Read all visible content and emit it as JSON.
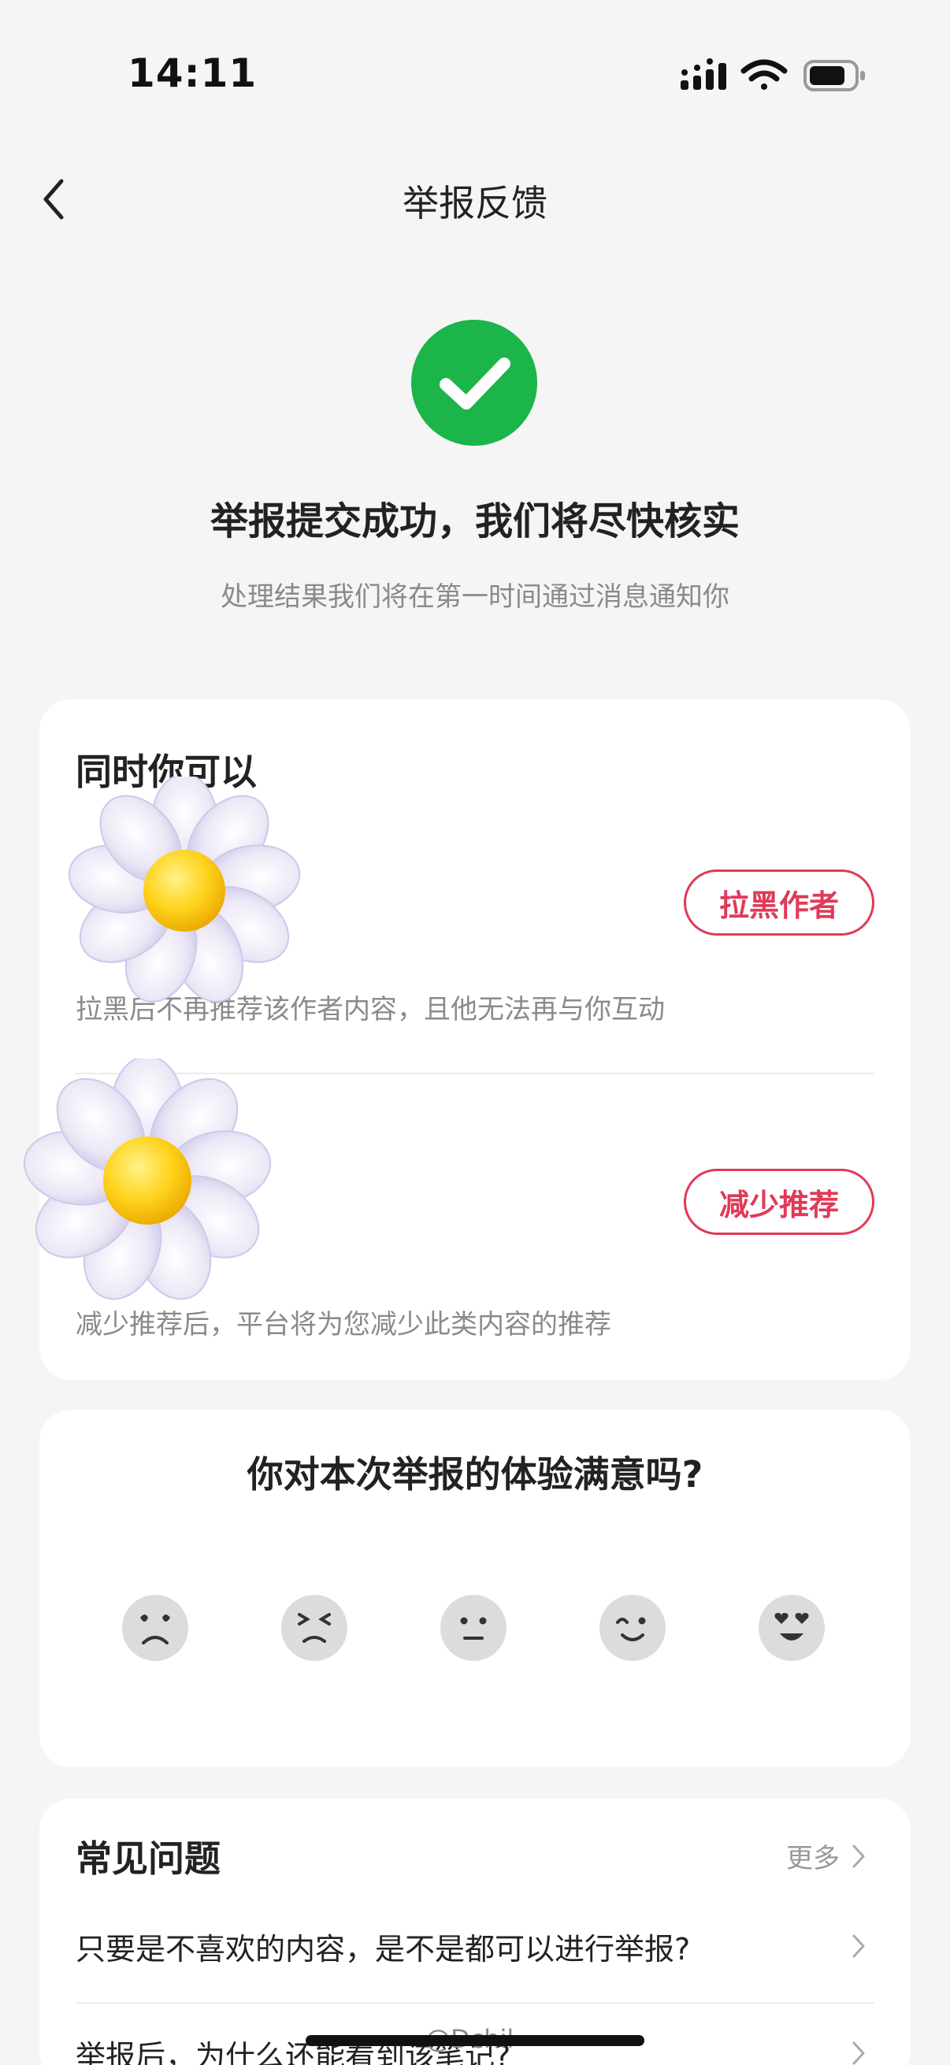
{
  "status_bar": {
    "time": "14:11",
    "icons": [
      "signal-icon",
      "wifi-icon",
      "battery-icon"
    ]
  },
  "nav": {
    "title": "举报反馈",
    "back_icon": "chevron-left-icon"
  },
  "success": {
    "icon": "check-circle-icon",
    "title": "举报提交成功，我们将尽快核实",
    "subtitle": "处理结果我们将在第一时间通过消息通知你"
  },
  "actions": {
    "heading": "同时你可以",
    "items": [
      {
        "button": "拉黑作者",
        "description": "拉黑后不再推荐该作者内容，且他无法再与你互动"
      },
      {
        "button": "减少推荐",
        "description": "减少推荐后，平台将为您减少此类内容的推荐"
      }
    ]
  },
  "survey": {
    "title": "你对本次举报的体验满意吗?",
    "options": [
      "very-unsatisfied-emoji",
      "unsatisfied-emoji",
      "neutral-emoji",
      "satisfied-emoji",
      "very-satisfied-emoji"
    ]
  },
  "faq": {
    "title": "常见问题",
    "more": "更多",
    "questions": [
      "只要是不喜欢的内容，是不是都可以进行举报?",
      "举报后，为什么还能看到该笔记?"
    ]
  },
  "watermark": "@Dchil",
  "colors": {
    "accent": "#e03a58",
    "success": "#1bb54a",
    "background": "#f5f5f5"
  }
}
